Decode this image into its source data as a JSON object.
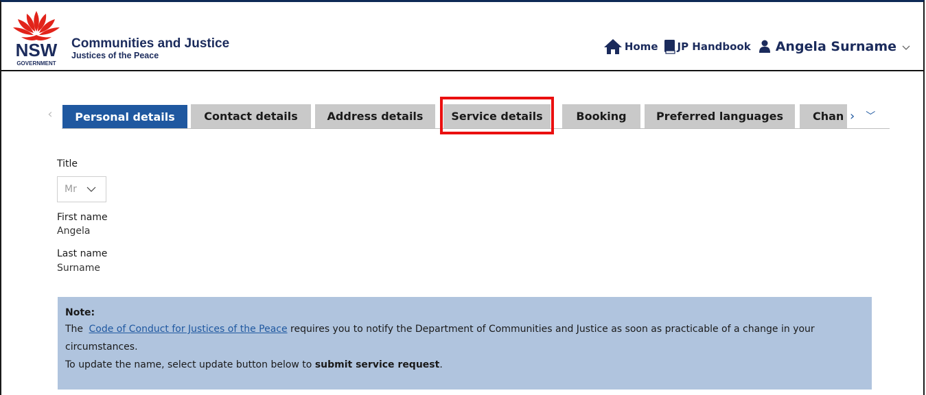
{
  "brand": {
    "gov_label": "NSW",
    "gov_sub": "GOVERNMENT",
    "title": "Communities and Justice",
    "subtitle": "Justices of the Peace"
  },
  "topnav": {
    "home_label": "Home",
    "handbook_label": "JP Handbook",
    "user_name": "Angela Surname",
    "icons": [
      "home-icon",
      "book-icon",
      "user-icon",
      "chevron-down-icon"
    ]
  },
  "tabs": {
    "items": [
      {
        "label": "Personal details",
        "active": true
      },
      {
        "label": "Contact details",
        "active": false
      },
      {
        "label": "Address details",
        "active": false
      },
      {
        "label": "Service details",
        "active": false,
        "highlighted": true
      },
      {
        "label": "Booking",
        "active": false
      },
      {
        "label": "Preferred languages",
        "active": false
      },
      {
        "label": "Chan",
        "active": false,
        "truncated": true
      }
    ],
    "scroll_left": "‹",
    "scroll_right": "›",
    "overflow_menu": "﹀"
  },
  "form": {
    "title_label": "Title",
    "title_value": "Mr",
    "first_name_label": "First name",
    "first_name_value": "Angela",
    "last_name_label": "Last name",
    "last_name_value": "Surname"
  },
  "note": {
    "heading": "Note:",
    "line1_prefix": "The",
    "link_text": "Code of Conduct for Justices of the Peace",
    "line1_suffix": " requires you to notify the Department of Communities and Justice as soon as practicable of a change in your circumstances.",
    "line2_prefix": "To update the name, select update button below to ",
    "line2_bold": "submit service request",
    "line2_suffix": "."
  },
  "colors": {
    "brand_navy": "#1b2b5c",
    "tab_active": "#1f58a0",
    "tab_inactive": "#c9c9c9",
    "highlight": "#ea1010",
    "note_bg": "#b0c4de",
    "logo_red": "#e2231a"
  }
}
